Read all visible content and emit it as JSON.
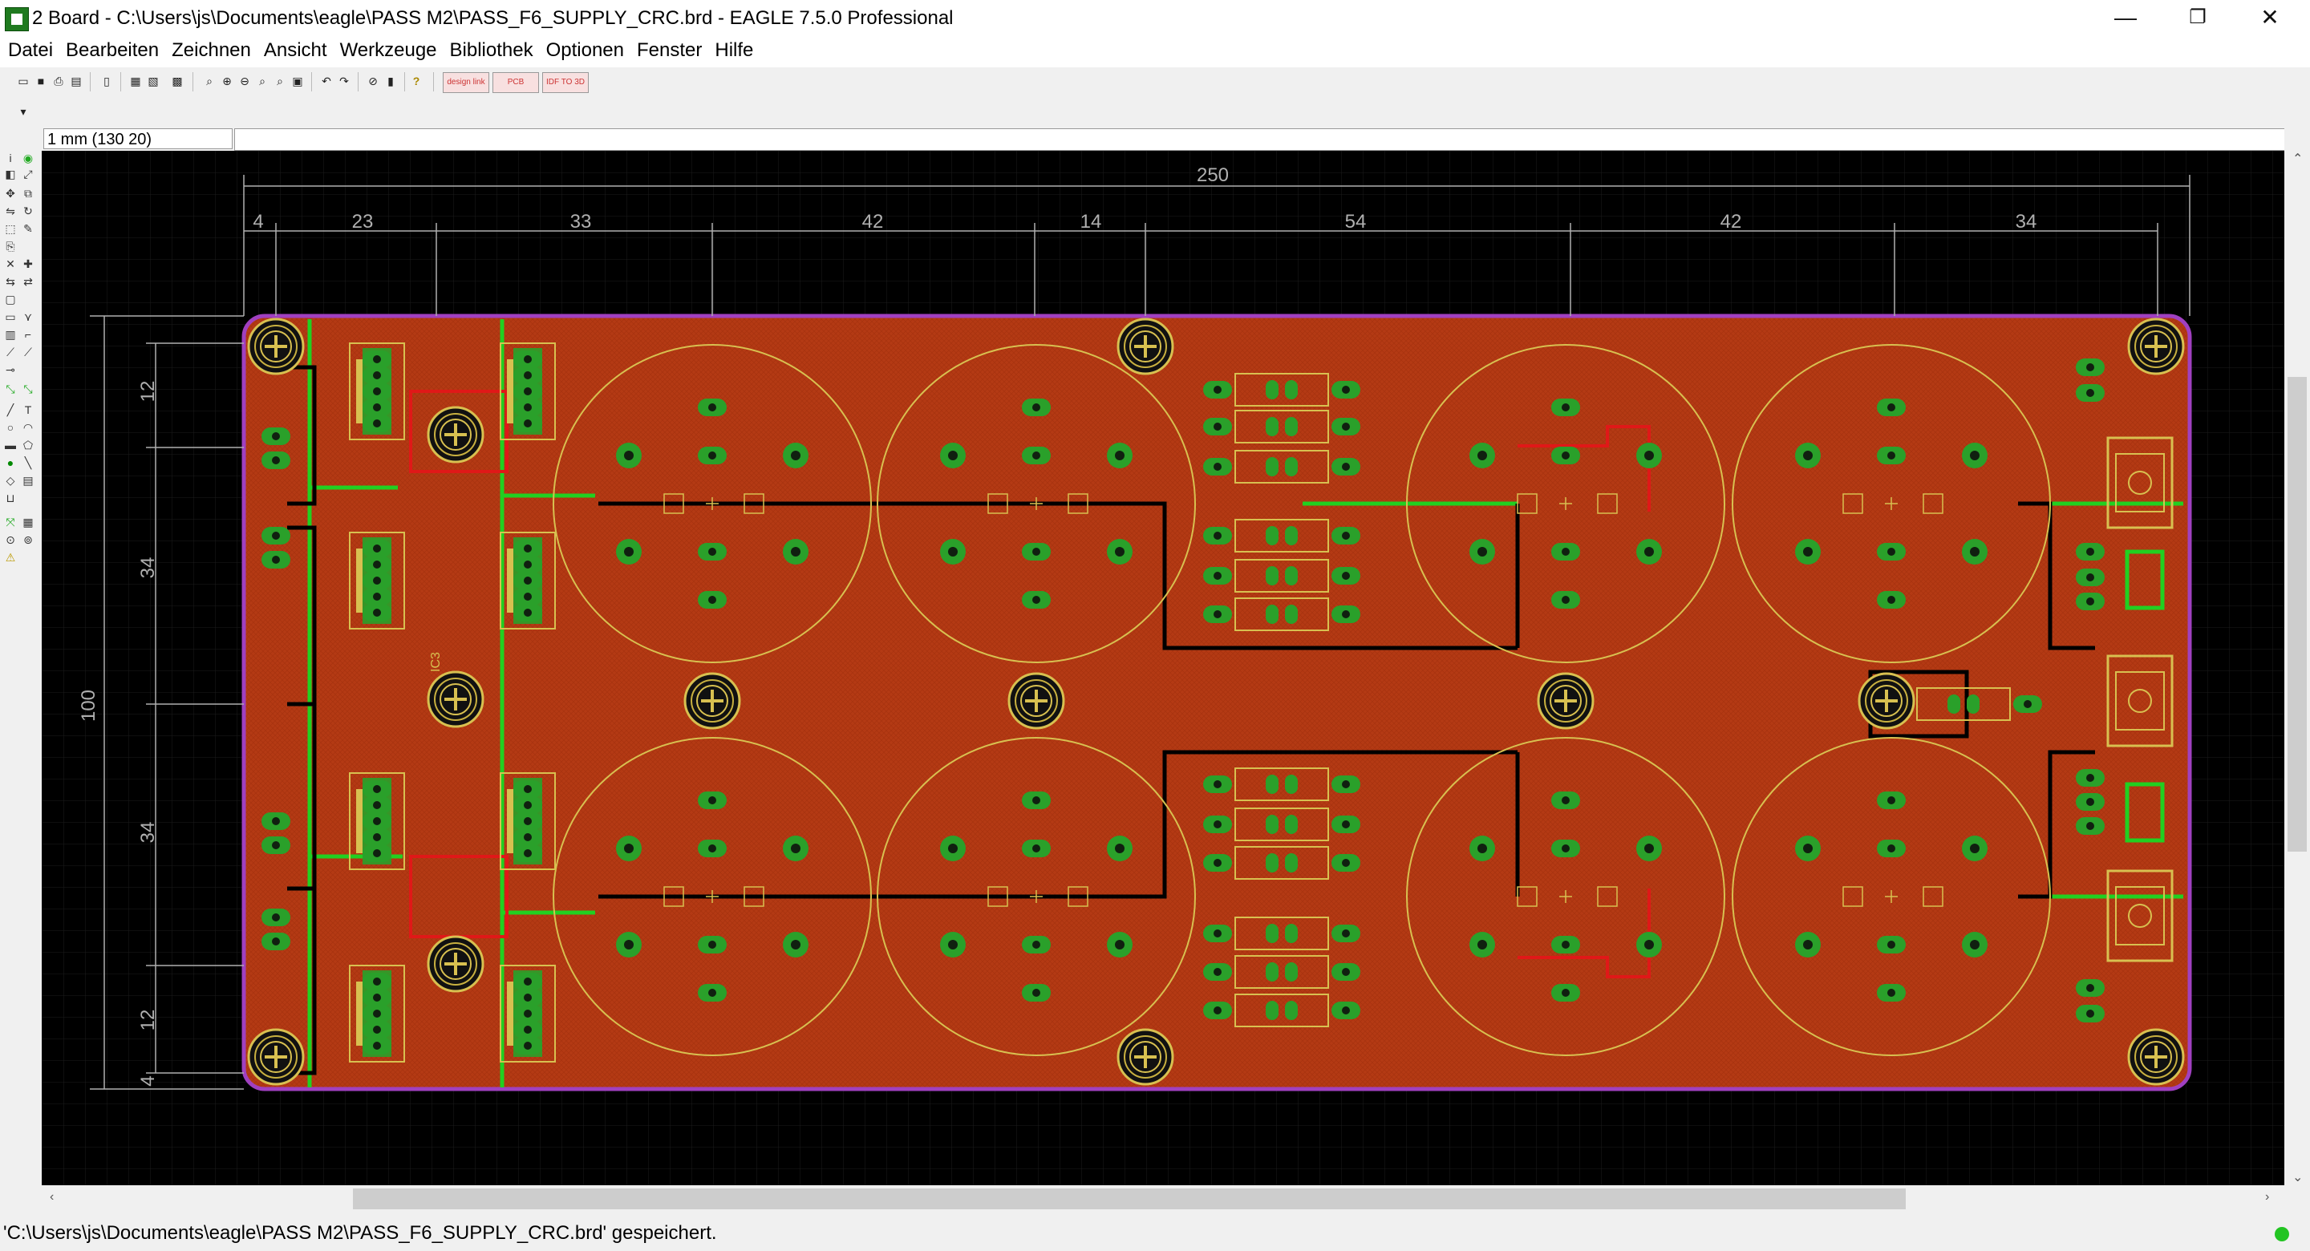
{
  "window": {
    "title": "2 Board - C:\\Users\\js\\Documents\\eagle\\PASS M2\\PASS_F6_SUPPLY_CRC.brd - EAGLE 7.5.0 Professional",
    "minimize": "—",
    "restore": "❐",
    "close": "✕"
  },
  "menu": [
    "Datei",
    "Bearbeiten",
    "Zeichnen",
    "Ansicht",
    "Werkzeuge",
    "Bibliothek",
    "Optionen",
    "Fenster",
    "Hilfe"
  ],
  "toolbar": {
    "help_label": "?",
    "design_link_label": "design link",
    "pcb_quote_label": "PCB QUOTE",
    "idf_label": "IDF TO 3D"
  },
  "coordinate": "1 mm (130 20)",
  "dimensions": {
    "overall_width": "250",
    "overall_height": "100",
    "top_segments": [
      "4",
      "23",
      "33",
      "42",
      "14",
      "54",
      "42",
      "34"
    ],
    "left_segments": [
      "12",
      "34",
      "34",
      "12",
      "4"
    ]
  },
  "silkscreen": {
    "label_ref": "IC3"
  },
  "status": {
    "message": "'C:\\Users\\js\\Documents\\eagle\\PASS M2\\PASS_F6_SUPPLY_CRC.brd' gespeichert."
  },
  "colors": {
    "background": "#000000",
    "copper_pour": "#b43a14",
    "board_outline": "#a040c0",
    "pad": "#2aa02a",
    "silkscreen": "#d8c050",
    "dimension": "#b0b0b0",
    "status_ok": "#22c422"
  }
}
